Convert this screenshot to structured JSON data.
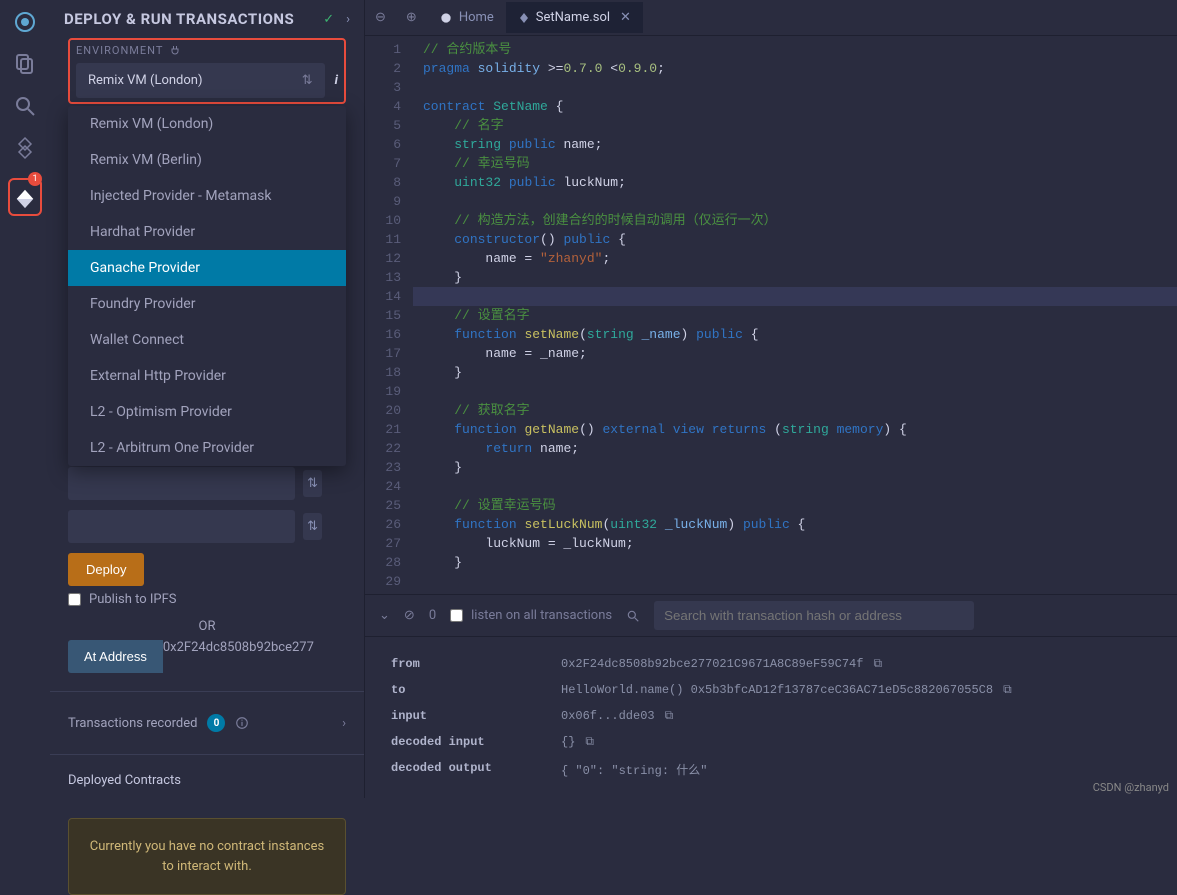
{
  "iconbar": {
    "badge": "1"
  },
  "panel": {
    "title": "DEPLOY & RUN TRANSACTIONS",
    "env_label": "ENVIRONMENT",
    "env_value": "Remix VM (London)",
    "env_options": [
      "Remix VM (London)",
      "Remix VM (Berlin)",
      "Injected Provider - Metamask",
      "Hardhat Provider",
      "Ganache Provider",
      "Foundry Provider",
      "Wallet Connect",
      "External Http Provider",
      "L2 - Optimism Provider",
      "L2 - Arbitrum One Provider"
    ],
    "deploy_label": "Deploy",
    "publish_label": "Publish to IPFS",
    "or_label": "OR",
    "at_address_label": "At Address",
    "at_address_value": "0x2F24dc8508b92bce277",
    "trx_recorded_label": "Transactions recorded",
    "trx_recorded_count": "0",
    "deployed_label": "Deployed Contracts",
    "deployed_empty": "Currently you have no contract instances to interact with."
  },
  "tabs": {
    "home": "Home",
    "file": "SetName.sol"
  },
  "code_lines": [
    {
      "n": "1",
      "seg": [
        {
          "c": "c-cm",
          "t": "// 合约版本号"
        }
      ]
    },
    {
      "n": "2",
      "seg": [
        {
          "c": "c-kw",
          "t": "pragma"
        },
        {
          "c": "c-pl",
          "t": " "
        },
        {
          "c": "c-id",
          "t": "solidity"
        },
        {
          "c": "c-pl",
          "t": " >="
        },
        {
          "c": "c-num",
          "t": "0.7.0"
        },
        {
          "c": "c-pl",
          "t": " <"
        },
        {
          "c": "c-num",
          "t": "0.9.0"
        },
        {
          "c": "c-pl",
          "t": ";"
        }
      ]
    },
    {
      "n": "3",
      "seg": []
    },
    {
      "n": "4",
      "seg": [
        {
          "c": "c-kw",
          "t": "contract"
        },
        {
          "c": "c-pl",
          "t": " "
        },
        {
          "c": "c-ty",
          "t": "SetName"
        },
        {
          "c": "c-pl",
          "t": " {"
        }
      ]
    },
    {
      "n": "5",
      "seg": [
        {
          "c": "c-pl",
          "t": "    "
        },
        {
          "c": "c-cm",
          "t": "// 名字"
        }
      ]
    },
    {
      "n": "6",
      "seg": [
        {
          "c": "c-pl",
          "t": "    "
        },
        {
          "c": "c-ty",
          "t": "string"
        },
        {
          "c": "c-pl",
          "t": " "
        },
        {
          "c": "c-kw",
          "t": "public"
        },
        {
          "c": "c-pl",
          "t": " name;"
        }
      ]
    },
    {
      "n": "7",
      "seg": [
        {
          "c": "c-pl",
          "t": "    "
        },
        {
          "c": "c-cm",
          "t": "// 幸运号码"
        }
      ]
    },
    {
      "n": "8",
      "seg": [
        {
          "c": "c-pl",
          "t": "    "
        },
        {
          "c": "c-ty",
          "t": "uint32"
        },
        {
          "c": "c-pl",
          "t": " "
        },
        {
          "c": "c-kw",
          "t": "public"
        },
        {
          "c": "c-pl",
          "t": " luckNum;"
        }
      ]
    },
    {
      "n": "9",
      "seg": []
    },
    {
      "n": "10",
      "seg": [
        {
          "c": "c-pl",
          "t": "    "
        },
        {
          "c": "c-cm",
          "t": "// 构造方法，创建合约的时候自动调用（仅运行一次）"
        }
      ]
    },
    {
      "n": "11",
      "seg": [
        {
          "c": "c-pl",
          "t": "    "
        },
        {
          "c": "c-kw",
          "t": "constructor"
        },
        {
          "c": "c-pl",
          "t": "() "
        },
        {
          "c": "c-kw",
          "t": "public"
        },
        {
          "c": "c-pl",
          "t": " {"
        }
      ]
    },
    {
      "n": "12",
      "seg": [
        {
          "c": "c-pl",
          "t": "        name = "
        },
        {
          "c": "c-str",
          "t": "\"zhanyd\""
        },
        {
          "c": "c-pl",
          "t": ";"
        }
      ]
    },
    {
      "n": "13",
      "seg": [
        {
          "c": "c-pl",
          "t": "    }"
        }
      ]
    },
    {
      "n": "14",
      "hl": true,
      "seg": []
    },
    {
      "n": "15",
      "seg": [
        {
          "c": "c-pl",
          "t": "    "
        },
        {
          "c": "c-cm",
          "t": "// 设置名字"
        }
      ]
    },
    {
      "n": "16",
      "seg": [
        {
          "c": "c-pl",
          "t": "    "
        },
        {
          "c": "c-kw",
          "t": "function"
        },
        {
          "c": "c-pl",
          "t": " "
        },
        {
          "c": "c-fn",
          "t": "setName"
        },
        {
          "c": "c-pl",
          "t": "("
        },
        {
          "c": "c-ty",
          "t": "string"
        },
        {
          "c": "c-pl",
          "t": " "
        },
        {
          "c": "c-id",
          "t": "_name"
        },
        {
          "c": "c-pl",
          "t": ") "
        },
        {
          "c": "c-kw",
          "t": "public"
        },
        {
          "c": "c-pl",
          "t": " {"
        }
      ]
    },
    {
      "n": "17",
      "seg": [
        {
          "c": "c-pl",
          "t": "        name = _name;"
        }
      ]
    },
    {
      "n": "18",
      "seg": [
        {
          "c": "c-pl",
          "t": "    }"
        }
      ]
    },
    {
      "n": "19",
      "seg": []
    },
    {
      "n": "20",
      "seg": [
        {
          "c": "c-pl",
          "t": "    "
        },
        {
          "c": "c-cm",
          "t": "// 获取名字"
        }
      ]
    },
    {
      "n": "21",
      "seg": [
        {
          "c": "c-pl",
          "t": "    "
        },
        {
          "c": "c-kw",
          "t": "function"
        },
        {
          "c": "c-pl",
          "t": " "
        },
        {
          "c": "c-fn",
          "t": "getName"
        },
        {
          "c": "c-pl",
          "t": "() "
        },
        {
          "c": "c-kw",
          "t": "external"
        },
        {
          "c": "c-pl",
          "t": " "
        },
        {
          "c": "c-kw",
          "t": "view"
        },
        {
          "c": "c-pl",
          "t": " "
        },
        {
          "c": "c-kw",
          "t": "returns"
        },
        {
          "c": "c-pl",
          "t": " ("
        },
        {
          "c": "c-ty",
          "t": "string"
        },
        {
          "c": "c-pl",
          "t": " "
        },
        {
          "c": "c-kw",
          "t": "memory"
        },
        {
          "c": "c-pl",
          "t": ") {"
        }
      ]
    },
    {
      "n": "22",
      "seg": [
        {
          "c": "c-pl",
          "t": "        "
        },
        {
          "c": "c-kw",
          "t": "return"
        },
        {
          "c": "c-pl",
          "t": " name;"
        }
      ]
    },
    {
      "n": "23",
      "seg": [
        {
          "c": "c-pl",
          "t": "    }"
        }
      ]
    },
    {
      "n": "24",
      "seg": []
    },
    {
      "n": "25",
      "seg": [
        {
          "c": "c-pl",
          "t": "    "
        },
        {
          "c": "c-cm",
          "t": "// 设置幸运号码"
        }
      ]
    },
    {
      "n": "26",
      "seg": [
        {
          "c": "c-pl",
          "t": "    "
        },
        {
          "c": "c-kw",
          "t": "function"
        },
        {
          "c": "c-pl",
          "t": " "
        },
        {
          "c": "c-fn",
          "t": "setLuckNum"
        },
        {
          "c": "c-pl",
          "t": "("
        },
        {
          "c": "c-ty",
          "t": "uint32"
        },
        {
          "c": "c-pl",
          "t": " "
        },
        {
          "c": "c-id",
          "t": "_luckNum"
        },
        {
          "c": "c-pl",
          "t": ") "
        },
        {
          "c": "c-kw",
          "t": "public"
        },
        {
          "c": "c-pl",
          "t": " {"
        }
      ]
    },
    {
      "n": "27",
      "seg": [
        {
          "c": "c-pl",
          "t": "        luckNum = _luckNum;"
        }
      ]
    },
    {
      "n": "28",
      "seg": [
        {
          "c": "c-pl",
          "t": "    }"
        }
      ]
    },
    {
      "n": "29",
      "seg": []
    }
  ],
  "terminal": {
    "zero": "0",
    "listen_label": "listen on all transactions",
    "search_placeholder": "Search with transaction hash or address",
    "rows": [
      {
        "k": "from",
        "v": "0x2F24dc8508b92bce277021C9671A8C89eF59C74f",
        "copy": true
      },
      {
        "k": "to",
        "v": "HelloWorld.name() 0x5b3bfcAD12f13787ceC36AC71eD5c882067055C8",
        "copy": true
      },
      {
        "k": "input",
        "v": "0x06f...dde03",
        "copy": true
      },
      {
        "k": "decoded input",
        "v": "{}",
        "copy": true
      },
      {
        "k": "decoded output",
        "v": "{\n    \"0\": \"string: 什么\""
      }
    ]
  },
  "watermark": "CSDN @zhanyd"
}
